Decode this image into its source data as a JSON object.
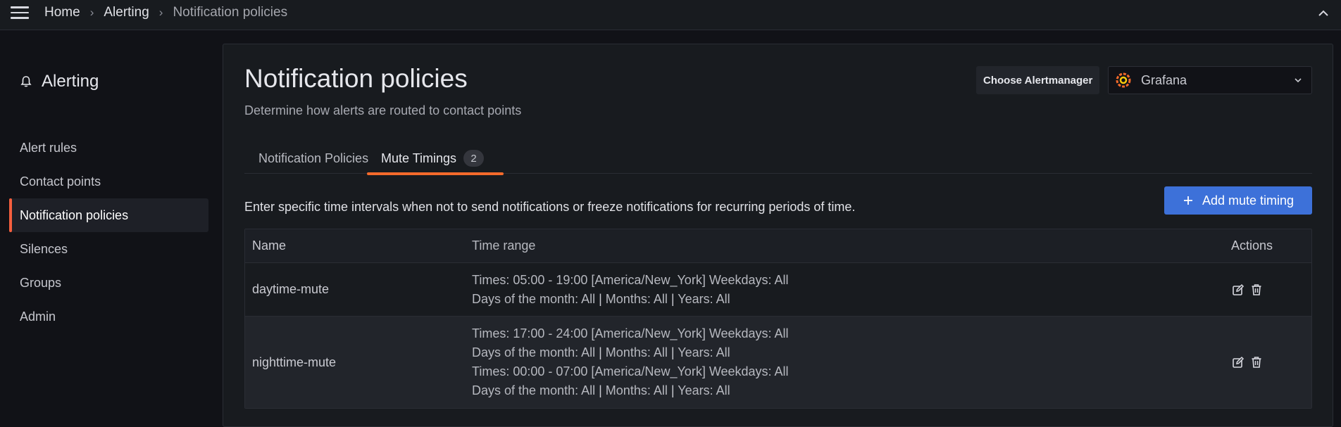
{
  "topbar": {
    "breadcrumbs": [
      "Home",
      "Alerting",
      "Notification policies"
    ],
    "menu_icon": "hamburger-menu-icon",
    "collapse_icon": "chevron-up-icon"
  },
  "sidebar": {
    "title": "Alerting",
    "title_icon": "bell-icon",
    "items": [
      {
        "label": "Alert rules",
        "active": false
      },
      {
        "label": "Contact points",
        "active": false
      },
      {
        "label": "Notification policies",
        "active": true
      },
      {
        "label": "Silences",
        "active": false
      },
      {
        "label": "Groups",
        "active": false
      },
      {
        "label": "Admin",
        "active": false
      }
    ]
  },
  "page": {
    "title": "Notification policies",
    "subtitle": "Determine how alerts are routed to contact points",
    "alertmanager_label": "Choose Alertmanager",
    "alertmanager_value": "Grafana",
    "alertmanager_icon": "grafana-logo-icon"
  },
  "tabs": [
    {
      "label": "Notification Policies",
      "active": false
    },
    {
      "label": "Mute Timings",
      "count": "2",
      "active": true
    }
  ],
  "mute_timings": {
    "description": "Enter specific time intervals when not to send notifications or freeze notifications for recurring periods of time.",
    "add_button_label": "Add mute timing",
    "columns": [
      "Name",
      "Time range",
      "Actions"
    ],
    "rows": [
      {
        "name": "daytime-mute",
        "ranges": [
          {
            "times": "Times: 05:00 - 19:00 [America/New_York] Weekdays: All",
            "dom": "Days of the month: All",
            "months": "Months: All",
            "years": "Years: All"
          }
        ]
      },
      {
        "name": "nighttime-mute",
        "ranges": [
          {
            "times": "Times: 17:00 - 24:00 [America/New_York] Weekdays: All",
            "dom": "Days of the month: All",
            "months": "Months: All",
            "years": "Years: All"
          },
          {
            "times": "Times: 00:00 - 07:00 [America/New_York] Weekdays: All",
            "dom": "Days of the month: All",
            "months": "Months: All",
            "years": "Years: All"
          }
        ]
      }
    ]
  },
  "colors": {
    "accent_orange": "#f55f3e",
    "primary_blue": "#3d71d9",
    "background": "#111217",
    "panel": "#181b1f"
  }
}
